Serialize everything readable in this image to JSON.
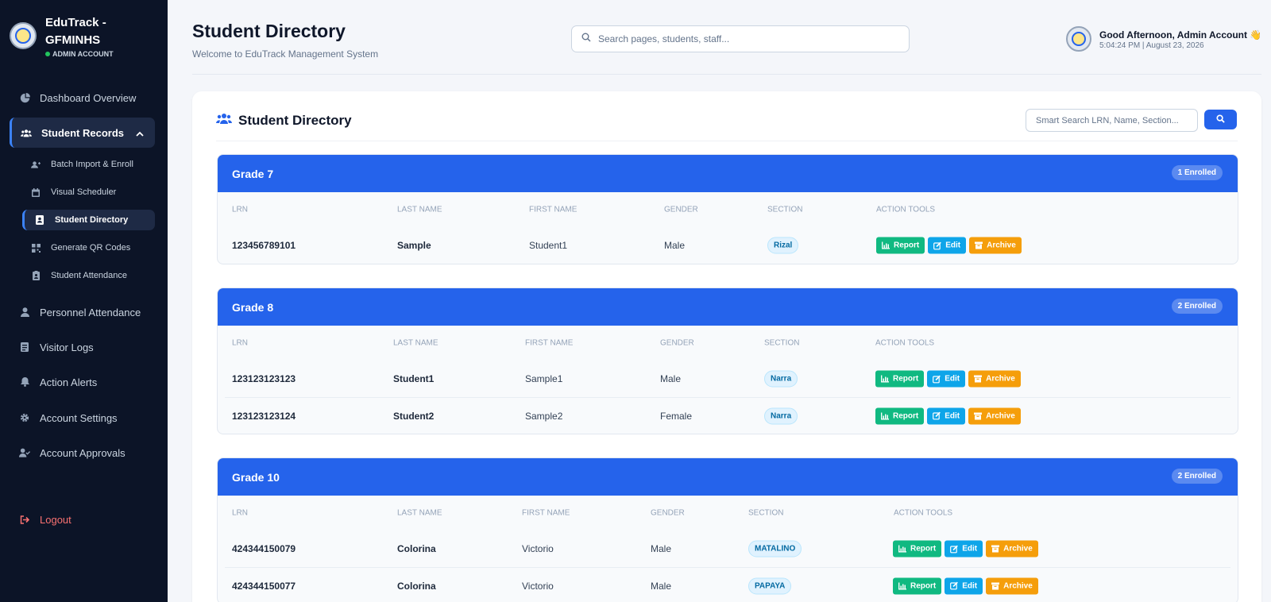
{
  "brand": {
    "title": "EduTrack - GFMINHS",
    "role": "ADMIN ACCOUNT"
  },
  "sidebar": {
    "items": [
      {
        "label": "Dashboard Overview",
        "icon": "pie-chart-icon"
      },
      {
        "label": "Student Records",
        "icon": "users-icon"
      },
      {
        "label": "Personnel Attendance",
        "icon": "user-icon"
      },
      {
        "label": "Visitor Logs",
        "icon": "clipboard-icon"
      },
      {
        "label": "Action Alerts",
        "icon": "bell-icon"
      },
      {
        "label": "Account Settings",
        "icon": "gear-icon"
      },
      {
        "label": "Account Approvals",
        "icon": "user-check-icon"
      }
    ],
    "sub_items": [
      {
        "label": "Batch Import & Enroll",
        "icon": "user-plus-icon"
      },
      {
        "label": "Visual Scheduler",
        "icon": "calendar-icon"
      },
      {
        "label": "Student Directory",
        "icon": "address-book-icon"
      },
      {
        "label": "Generate QR Codes",
        "icon": "qrcode-icon"
      },
      {
        "label": "Student Attendance",
        "icon": "clipboard-user-icon"
      }
    ],
    "logout": "Logout"
  },
  "header": {
    "title": "Student Directory",
    "subtitle": "Welcome to EduTrack Management System",
    "search_placeholder": "Search pages, students, staff...",
    "greeting": "Good Afternoon, Admin Account 👋",
    "clock": "5:04:24 PM | August 23, 2026"
  },
  "directory": {
    "title": "Student Directory",
    "search_placeholder": "Smart Search LRN, Name, Section...",
    "columns": [
      "LRN",
      "LAST NAME",
      "FIRST NAME",
      "GENDER",
      "SECTION",
      "ACTION TOOLS"
    ],
    "actions": {
      "report": "Report",
      "edit": "Edit",
      "archive": "Archive"
    },
    "grades": [
      {
        "name": "Grade 7",
        "badge": "1 Enrolled",
        "rows": [
          {
            "lrn": "123456789101",
            "last": "Sample",
            "first": "Student1",
            "gender": "Male",
            "section": "Rizal"
          }
        ]
      },
      {
        "name": "Grade 8",
        "badge": "2 Enrolled",
        "rows": [
          {
            "lrn": "123123123123",
            "last": "Student1",
            "first": "Sample1",
            "gender": "Male",
            "section": "Narra"
          },
          {
            "lrn": "123123123124",
            "last": "Student2",
            "first": "Sample2",
            "gender": "Female",
            "section": "Narra"
          }
        ]
      },
      {
        "name": "Grade 10",
        "badge": "2 Enrolled",
        "rows": [
          {
            "lrn": "424344150079",
            "last": "Colorina",
            "first": "Victorio",
            "gender": "Male",
            "section": "MATALINO"
          },
          {
            "lrn": "424344150077",
            "last": "Colorina",
            "first": "Victorio",
            "gender": "Male",
            "section": "PAPAYA"
          }
        ]
      }
    ]
  },
  "colors": {
    "accent": "#2563eb",
    "sidebar_bg": "#0c1427",
    "report": "#10b981",
    "edit": "#0ea5e9",
    "archive": "#f59e0b"
  }
}
